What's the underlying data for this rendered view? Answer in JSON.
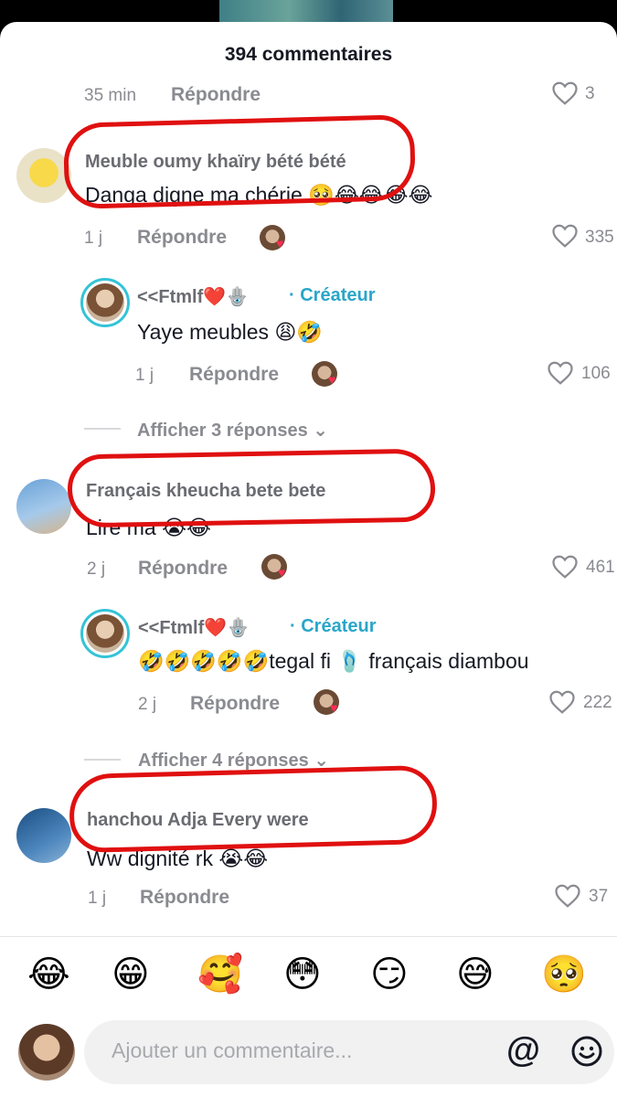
{
  "header": {
    "title": "394 commentaires"
  },
  "comments": [
    {
      "time": "35 min",
      "reply": "Répondre",
      "likes": "3"
    },
    {
      "username": "Meuble oumy khaïry bété bété",
      "text": "Danga digne ma chérie 🥺😂😂😂😂",
      "time": "1 j",
      "reply": "Répondre",
      "likes": "335"
    },
    {
      "creator": "<<Ftmlf❤️🪬",
      "tag": "Créateur",
      "text": "Yaye meubles 😩🤣",
      "time": "1 j",
      "reply": "Répondre",
      "likes": "106"
    },
    {
      "show_replies": "Afficher 3 réponses"
    },
    {
      "username": "Français kheucha bete bete",
      "text": "Lire ma 😭😂",
      "time": "2 j",
      "reply": "Répondre",
      "likes": "461"
    },
    {
      "creator": "<<Ftmlf❤️🪬",
      "tag": "Créateur",
      "text": "🤣🤣🤣🤣🤣tegal fi 🩴 français diambou",
      "time": "2 j",
      "reply": "Répondre",
      "likes": "222"
    },
    {
      "show_replies": "Afficher 4 réponses"
    },
    {
      "username": "hanchou Adja Every were",
      "text": "Ww dignité rk 😭😂",
      "time": "1 j",
      "reply": "Répondre",
      "likes": "37"
    }
  ],
  "emoji_bar": [
    "😂",
    "😁",
    "🥰",
    "😳",
    "😏",
    "😅",
    "🥺"
  ],
  "input": {
    "placeholder": "Ajouter un commentaire...",
    "at_symbol": "@"
  },
  "icons": {
    "like": "heart-outline-icon",
    "mention": "at-icon",
    "emoji": "smiley-icon",
    "expand": "chevron-down-icon"
  },
  "colors": {
    "creator_accent": "#2aa6c9",
    "annotation_red": "#e01010",
    "heart_red": "#fe2c55"
  }
}
